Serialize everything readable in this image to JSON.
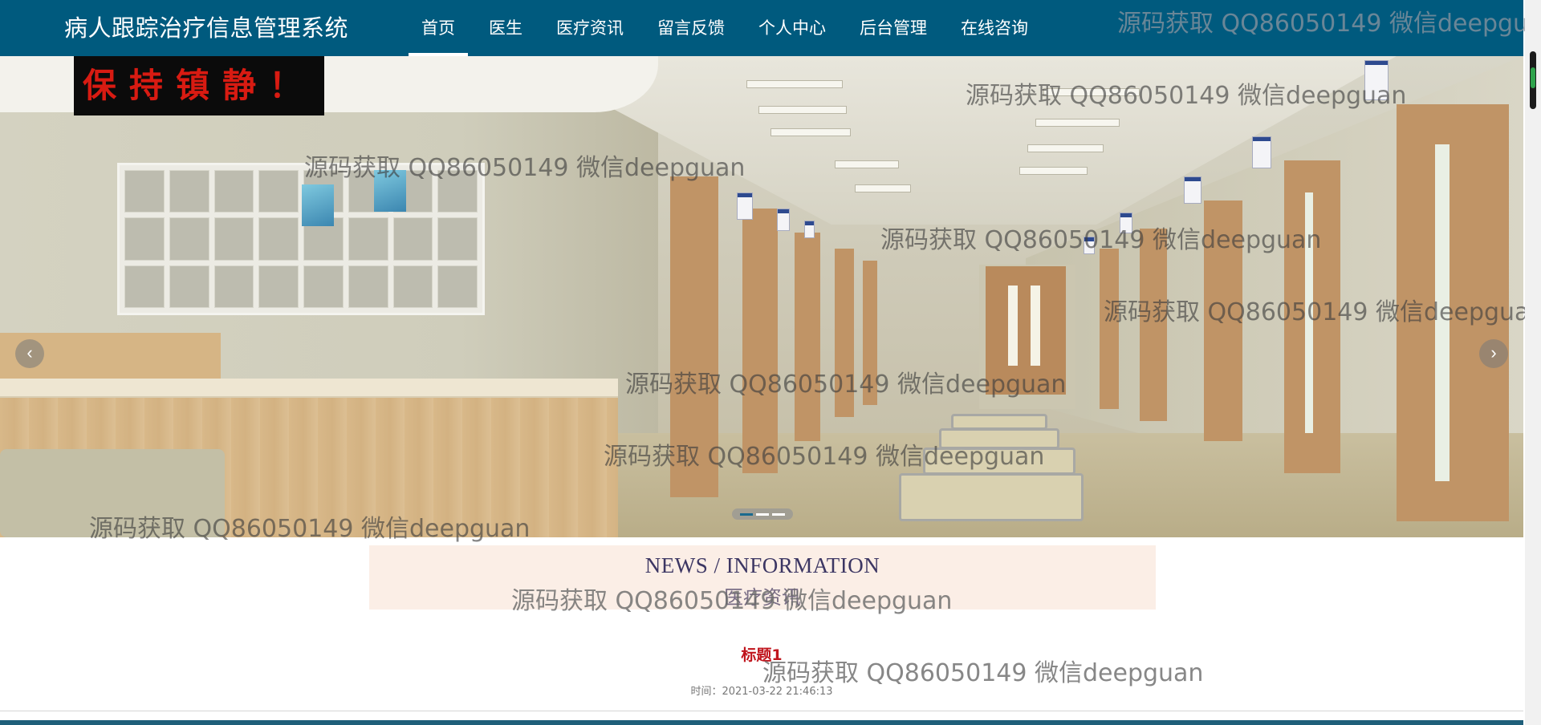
{
  "brand": {
    "title": "病人跟踪治疗信息管理系统"
  },
  "nav": {
    "items": [
      {
        "label": "首页",
        "active": true
      },
      {
        "label": "医生",
        "active": false
      },
      {
        "label": "医疗资讯",
        "active": false
      },
      {
        "label": "留言反馈",
        "active": false
      },
      {
        "label": "个人中心",
        "active": false
      },
      {
        "label": "后台管理",
        "active": false
      },
      {
        "label": "在线咨询",
        "active": false
      }
    ]
  },
  "carousel": {
    "sign_text": "保持镇静！",
    "prev_icon": "chevron-left-icon",
    "next_icon": "chevron-right-icon",
    "prev_glyph": "‹",
    "next_glyph": "›",
    "slide_count": 3,
    "active_slide": 1
  },
  "news": {
    "header_en": "NEWS / INFORMATION",
    "header_cn": "医疗资讯",
    "items": [
      {
        "title": "标题1",
        "time": "时间：2021-03-22 21:46:13"
      }
    ]
  },
  "watermark": {
    "text": "源码获取 QQ86050149 微信deepguan"
  },
  "colors": {
    "nav_bg": "#005a7e",
    "news_header_bg": "#fbeee6",
    "news_title": "#c0151d",
    "news_en": "#3c3663"
  }
}
